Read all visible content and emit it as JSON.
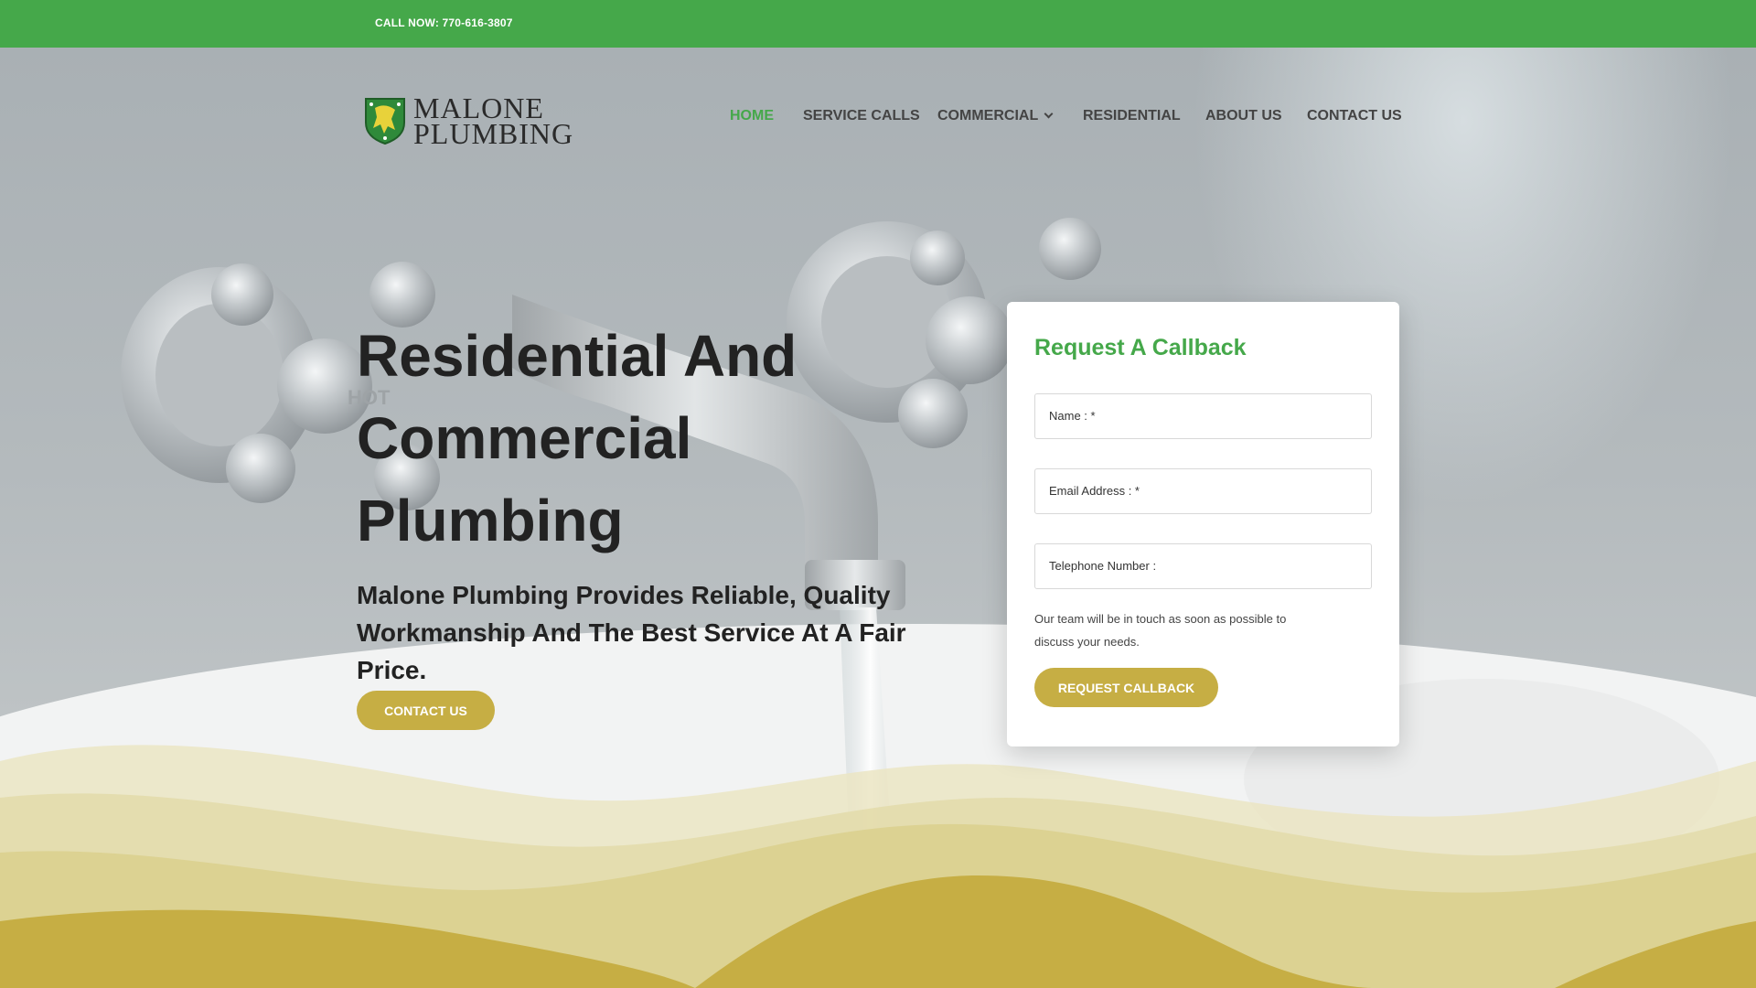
{
  "topbar": {
    "call_text": "CALL NOW: 770-616-3807"
  },
  "logo": {
    "line1": "MALONE",
    "line2": "PLUMBING"
  },
  "nav": {
    "items": [
      {
        "label": "HOME",
        "active": true
      },
      {
        "label": "SERVICE CALLS",
        "active": false
      },
      {
        "label": "COMMERCIAL",
        "active": false,
        "has_dropdown": true
      },
      {
        "label": "RESIDENTIAL",
        "active": false
      },
      {
        "label": "ABOUT US",
        "active": false
      },
      {
        "label": "CONTACT US",
        "active": false
      }
    ]
  },
  "hero": {
    "headline_lines": [
      "Residential And",
      "Commercial",
      "Plumbing"
    ],
    "subhead_lines": [
      "Malone Plumbing Provides Reliable, Quality",
      "Workmanship And The Best Service At A Fair Price."
    ],
    "button_label": "CONTACT US",
    "faucet_label": "HOT"
  },
  "callback_form": {
    "title": "Request A Callback",
    "fields": [
      {
        "placeholder": "Name : *"
      },
      {
        "placeholder": "Email Address : *"
      },
      {
        "placeholder": "Telephone Number :"
      }
    ],
    "note_lines": [
      "Our team will be in touch as soon as possible to",
      "discuss your needs."
    ],
    "submit_label": "REQUEST CALLBACK"
  },
  "colors": {
    "brand_green": "#45a84a",
    "accent_gold": "#c6ae44",
    "text_dark": "#222222"
  }
}
